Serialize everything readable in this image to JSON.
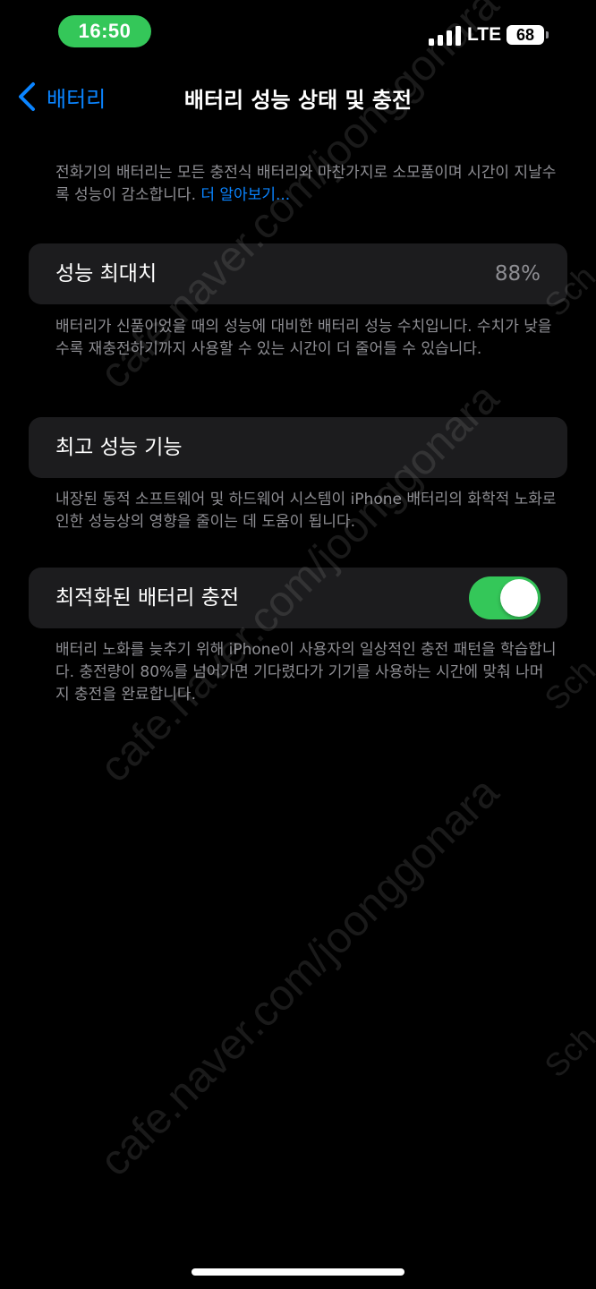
{
  "status_bar": {
    "time": "16:50",
    "network": "LTE",
    "battery": "68"
  },
  "nav": {
    "back_label": "배터리",
    "title": "배터리 성능 상태 및 충전"
  },
  "header": {
    "description": "전화기의 배터리는 모든 충전식 배터리와 마찬가지로 소모품이며 시간이 지날수록 성능이 감소합니다. ",
    "link": "더 알아보기..."
  },
  "max_capacity": {
    "label": "성능 최대치",
    "value": "88%",
    "footer": "배터리가 신품이었을 때의 성능에 대비한 배터리 성능 수치입니다. 수치가 낮을수록 재충전하기까지 사용할 수 있는 시간이 더 줄어들 수 있습니다."
  },
  "peak_performance": {
    "label": "최고 성능 기능",
    "footer": "내장된 동적 소프트웨어 및 하드웨어 시스템이 iPhone 배터리의 화학적 노화로 인한 성능상의 영향을 줄이는 데 도움이 됩니다."
  },
  "optimized_charging": {
    "label": "최적화된 배터리 충전",
    "enabled": true,
    "footer": "배터리 노화를 늦추기 위해 iPhone이 사용자의 일상적인 충전 패턴을 학습합니다. 충전량이 80%를 넘어가면 기다렸다가 기기를 사용하는 시간에 맞춰 나머지 충전을 완료합니다."
  },
  "watermark": {
    "text": "cafe.naver.com/joonggonara",
    "side_text": "Sch"
  },
  "colors": {
    "accent": "#0a84ff",
    "toggle_on": "#34c759",
    "cell_bg": "#1c1c1e",
    "secondary_text": "#8e8e93"
  }
}
